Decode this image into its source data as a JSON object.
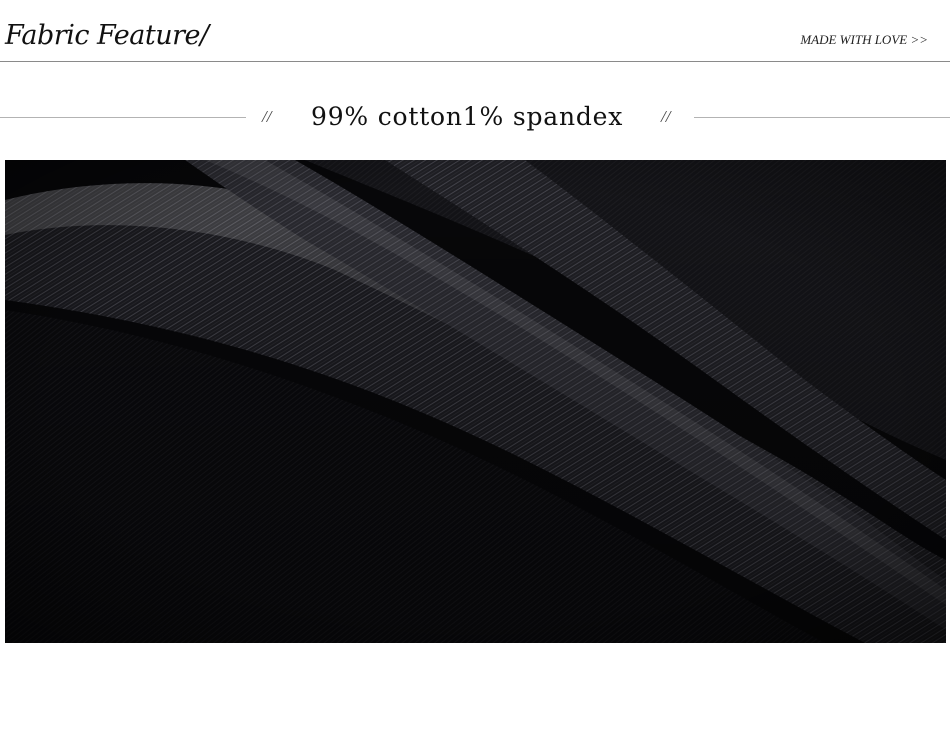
{
  "header": {
    "title": "Fabric Feature/",
    "tagline": "MADE WITH LOVE >>"
  },
  "subhead": {
    "left_slashes": "//",
    "text": "99% cotton1% spandex",
    "right_slashes": "//"
  },
  "photo": {
    "subject": "dark denim fabric close-up",
    "colors": {
      "base": "#070709",
      "highlight": "#3a3a40",
      "mid": "#1a1a1e"
    }
  }
}
